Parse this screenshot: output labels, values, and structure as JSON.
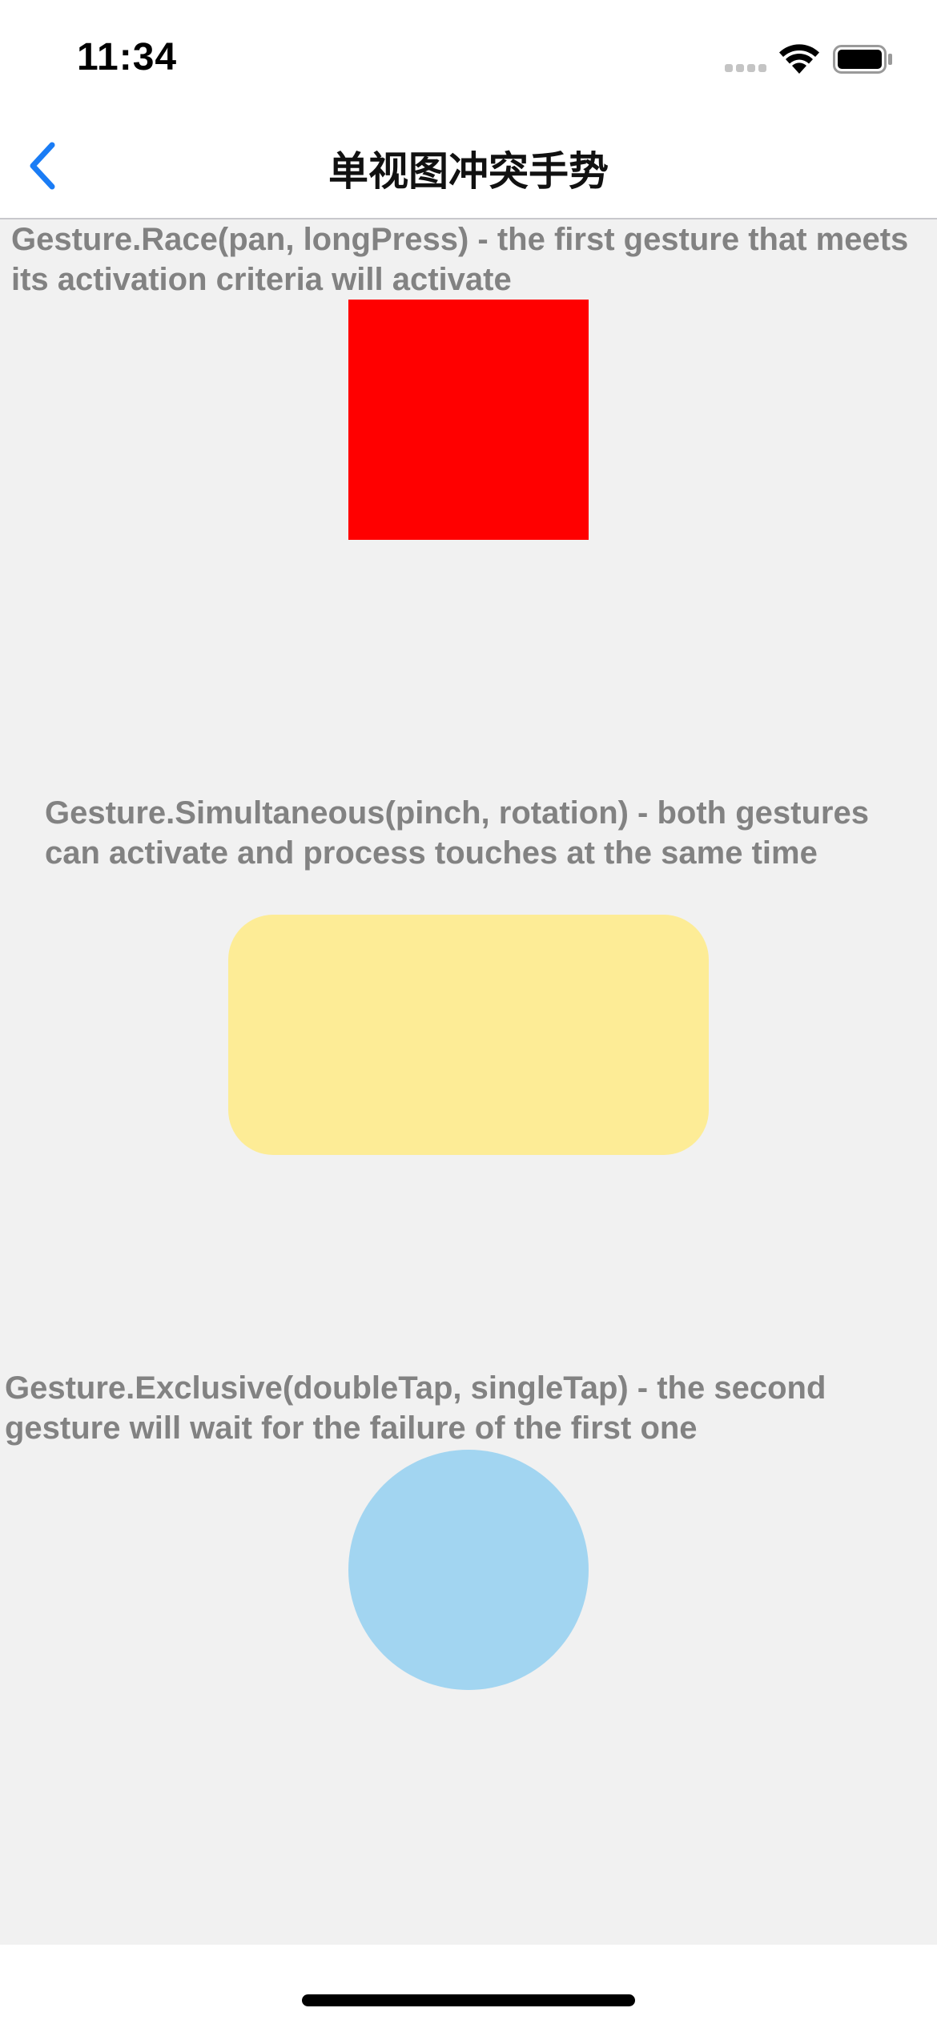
{
  "status_bar": {
    "time": "11:34",
    "icons": [
      "cellular-signal-icon",
      "wifi-icon",
      "battery-icon"
    ]
  },
  "nav": {
    "back_icon": "chevron-left-icon",
    "title": "单视图冲突手势"
  },
  "sections": {
    "race": {
      "description": "Gesture.Race(pan, longPress) - the first gesture that meets its activation criteria will activate",
      "shape": "square",
      "color": "#ff0000"
    },
    "simultaneous": {
      "description": "Gesture.Simultaneous(pinch, rotation) - both gestures can activate and process touches at the same time",
      "shape": "rounded-rectangle",
      "color": "#fdec96"
    },
    "exclusive": {
      "description": "Gesture.Exclusive(doubleTap, singleTap) - the second gesture will wait for the failure of the first one",
      "shape": "circle",
      "color": "#a2d5f1"
    }
  },
  "colors": {
    "accent": "#1a7cf5",
    "description_text": "#828282",
    "content_background": "#f1f1f1"
  }
}
